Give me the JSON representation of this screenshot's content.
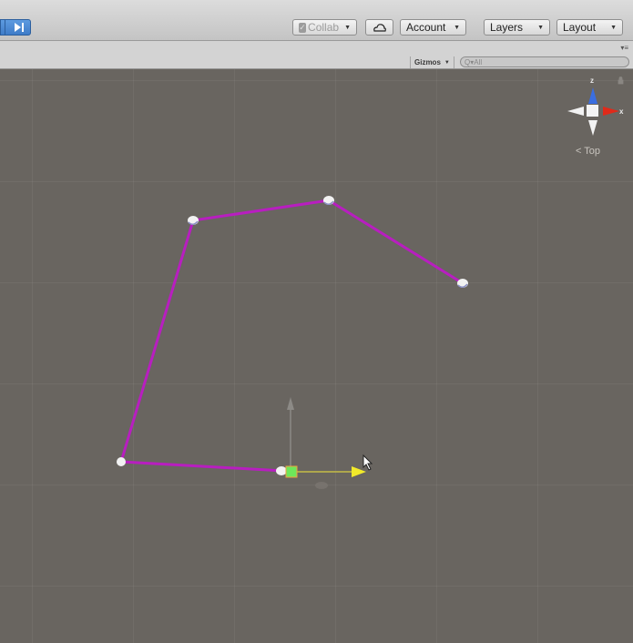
{
  "toolbar": {
    "collab_label": "Collab",
    "account_label": "Account",
    "layers_label": "Layers",
    "layout_label": "Layout"
  },
  "scene_header": {
    "gizmos_label": "Gizmos",
    "search_placeholder": "Q▾All"
  },
  "scene": {
    "view_label": "Top",
    "gizmo_axes": [
      "z",
      "x"
    ],
    "path_color": "#b81ec0",
    "grid_color": "#696560"
  }
}
